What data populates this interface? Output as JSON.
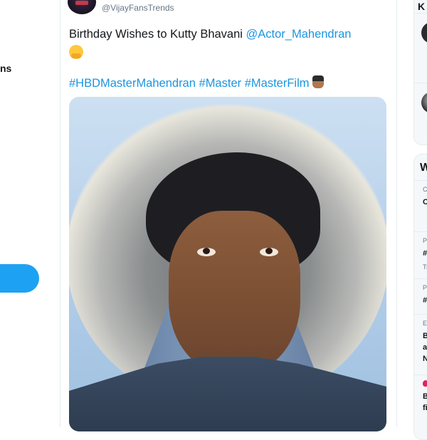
{
  "left_nav": {
    "partial_label": "ns"
  },
  "tweet": {
    "handle": "@VijayFansTrends",
    "text_prefix": "Birthday Wishes to Kutty Bhavani",
    "mention": "@Actor_Mahendran",
    "emoji_after_text": "hugging-face-emoji",
    "hashtags": [
      "#HBDMasterMahendran",
      "#Master",
      "#MasterFilm"
    ],
    "emoji_after_hashtags": "man-emoji",
    "media": "photo-of-man-looking-upward"
  },
  "right_sidebar": {
    "panel1_heading": "K",
    "panel2_heading": "W",
    "trends": [
      {
        "small": "C",
        "big": [
          "C"
        ]
      },
      {
        "small": "P",
        "big": [
          "#"
        ],
        "extra": "Tr"
      },
      {
        "small": "P",
        "big": [
          "#"
        ]
      },
      {
        "small": "E",
        "big": [
          "B",
          "al",
          "N"
        ]
      },
      {
        "small": "",
        "icon": "fire-icon",
        "big": [
          "B",
          "fi"
        ]
      }
    ]
  },
  "colors": {
    "accent": "#1da1f2",
    "link": "#1b95e0",
    "text": "#14171a",
    "muted": "#657786",
    "border": "#e6ecf0"
  }
}
